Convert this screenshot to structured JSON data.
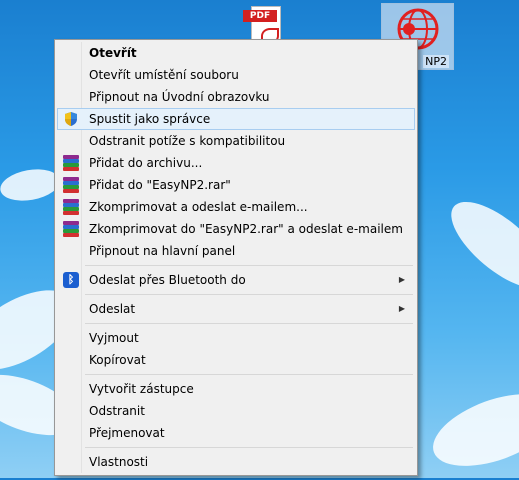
{
  "desktop": {
    "pdf_icon_tag": "PDF",
    "app_icon_label": "NP2"
  },
  "menu": {
    "items": [
      {
        "label": "Otevřít",
        "bold": true
      },
      {
        "label": "Otevřít umístění souboru"
      },
      {
        "label": "Připnout na Úvodní obrazovku"
      },
      {
        "label": "Spustit jako správce",
        "icon": "shield-icon",
        "hover": true
      },
      {
        "label": "Odstranit potíže s kompatibilitou"
      },
      {
        "label": "Přidat do archivu...",
        "icon": "winrar-icon"
      },
      {
        "label": "Přidat do \"EasyNP2.rar\"",
        "icon": "winrar-icon"
      },
      {
        "label": "Zkomprimovat a odeslat e-mailem...",
        "icon": "winrar-icon"
      },
      {
        "label": "Zkomprimovat do \"EasyNP2.rar\" a odeslat e-mailem",
        "icon": "winrar-icon"
      },
      {
        "label": "Připnout na hlavní panel"
      },
      {
        "label": "Odeslat přes Bluetooth do",
        "icon": "bluetooth-icon",
        "submenu": true
      },
      {
        "label": "Odeslat",
        "submenu": true
      },
      {
        "label": "Vyjmout"
      },
      {
        "label": "Kopírovat"
      },
      {
        "label": "Vytvořit zástupce"
      },
      {
        "label": "Odstranit"
      },
      {
        "label": "Přejmenovat"
      },
      {
        "label": "Vlastnosti"
      }
    ],
    "submenu_arrow": "▶"
  },
  "colors": {
    "hover_bg": "#e5f1fb",
    "menu_bg": "#f0f0f0",
    "winrar_stack": [
      "#8e2a8e",
      "#2a6fd0",
      "#2a9a3a",
      "#d23030"
    ]
  }
}
